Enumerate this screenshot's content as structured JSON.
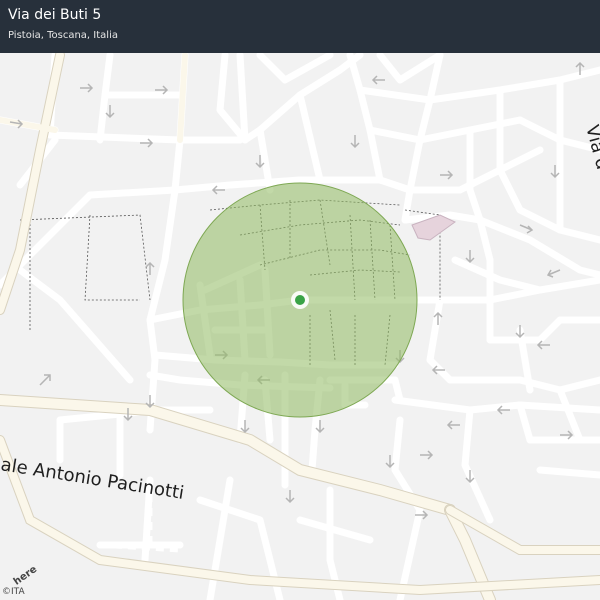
{
  "header": {
    "title": "Via dei Buti 5",
    "subtitle": "Pistoia, Toscana, Italia"
  },
  "map": {
    "street_labels": {
      "pacinotti": "ale  Antonio  Pacinotti",
      "edge": "Via d"
    },
    "marker": {
      "icon": "location-dot-icon",
      "color": "#3aa346"
    },
    "accuracy_radius_color": "#9bbf6e",
    "logo_text": "here",
    "copyright": "©ITA"
  }
}
